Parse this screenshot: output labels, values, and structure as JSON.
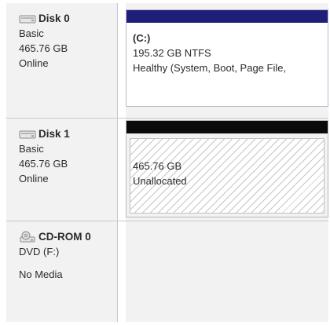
{
  "disks": [
    {
      "name": "Disk 0",
      "type": "Basic",
      "size": "465.76 GB",
      "status": "Online",
      "icon": "hard-disk-icon",
      "volume": {
        "label": "(C:)",
        "size_fs": "195.32 GB NTFS",
        "status": "Healthy (System, Boot, Page File,",
        "bar_color": "#1f1f7a"
      }
    },
    {
      "name": "Disk 1",
      "type": "Basic",
      "size": "465.76 GB",
      "status": "Online",
      "icon": "hard-disk-icon",
      "volume": {
        "size": "465.76 GB",
        "status": "Unallocated",
        "bar_color": "#0a0a0a"
      }
    },
    {
      "name": "CD-ROM 0",
      "type": "DVD (F:)",
      "status": "No Media",
      "icon": "cd-rom-icon"
    }
  ]
}
